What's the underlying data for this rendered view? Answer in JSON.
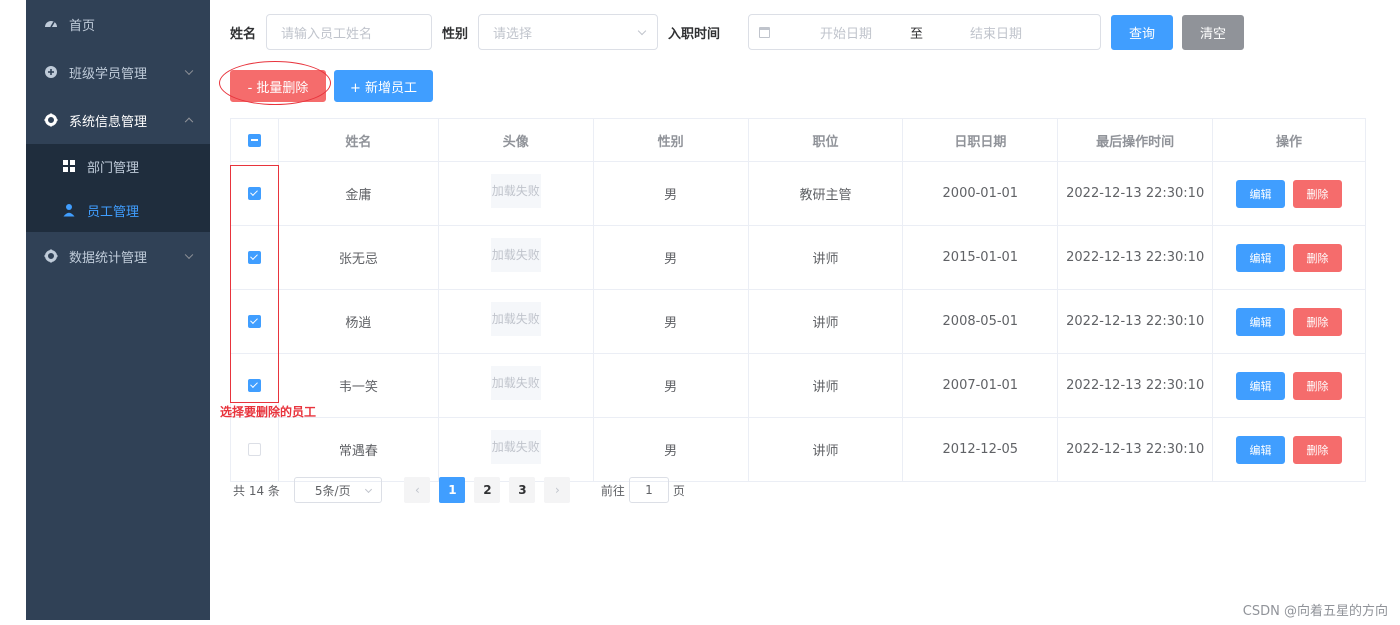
{
  "sidebar": {
    "items": [
      {
        "label": "首页",
        "icon": "dashboard-icon"
      },
      {
        "label": "班级学员管理",
        "icon": "plus-circle-icon"
      },
      {
        "label": "系统信息管理",
        "icon": "gear-icon"
      },
      {
        "label": "数据统计管理",
        "icon": "gear-icon"
      }
    ],
    "submenu": [
      {
        "label": "部门管理",
        "icon": "grid-icon"
      },
      {
        "label": "员工管理",
        "icon": "user-icon"
      }
    ]
  },
  "search": {
    "name_label": "姓名",
    "name_placeholder": "请输入员工姓名",
    "gender_label": "性别",
    "gender_placeholder": "请选择",
    "date_label": "入职时间",
    "start_placeholder": "开始日期",
    "range_sep": "至",
    "end_placeholder": "结束日期",
    "query_label": "查询",
    "clear_label": "清空"
  },
  "actions": {
    "batch_delete": "- 批量删除",
    "add_employee": "+ 新增员工"
  },
  "table": {
    "headers": [
      "姓名",
      "头像",
      "性别",
      "职位",
      "日职日期",
      "最后操作时间",
      "操作"
    ],
    "avatar_text": "加载失败",
    "edit_label": "编辑",
    "delete_label": "删除",
    "rows": [
      {
        "name": "金庸",
        "gender": "男",
        "job": "教研主管",
        "entry": "2000-01-01",
        "updated": "2022-12-13 22:30:10",
        "checked": true
      },
      {
        "name": "张无忌",
        "gender": "男",
        "job": "讲师",
        "entry": "2015-01-01",
        "updated": "2022-12-13 22:30:10",
        "checked": true
      },
      {
        "name": "杨逍",
        "gender": "男",
        "job": "讲师",
        "entry": "2008-05-01",
        "updated": "2022-12-13 22:30:10",
        "checked": true
      },
      {
        "name": "韦一笑",
        "gender": "男",
        "job": "讲师",
        "entry": "2007-01-01",
        "updated": "2022-12-13 22:30:10",
        "checked": true
      },
      {
        "name": "常遇春",
        "gender": "男",
        "job": "讲师",
        "entry": "2012-12-05",
        "updated": "2022-12-13 22:30:10",
        "checked": false
      }
    ]
  },
  "annotation": {
    "note": "选择要删除的员工",
    "color": "#e8343d"
  },
  "pagination": {
    "total": "共 14 条",
    "page_size": "5条/页",
    "pages": [
      "1",
      "2",
      "3"
    ],
    "current": "1",
    "goto_prefix": "前往",
    "goto_value": "1",
    "goto_suffix": "页"
  },
  "colors": {
    "sidebar_bg": "#304156",
    "primary": "#409eff",
    "danger": "#f56c6c",
    "info": "#909399"
  },
  "watermark": "CSDN @向着五星的方向"
}
